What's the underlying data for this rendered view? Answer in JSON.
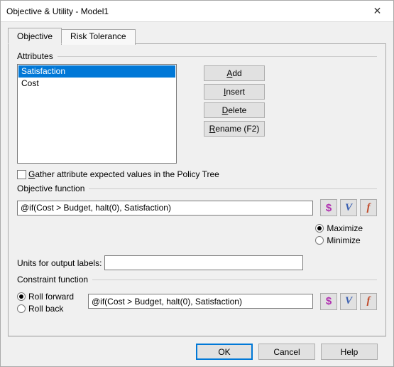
{
  "window": {
    "title": "Objective & Utility - Model1"
  },
  "tabs": {
    "objective": "Objective",
    "risk_tolerance": "Risk Tolerance"
  },
  "attributes": {
    "group_label": "Attributes",
    "items": [
      "Satisfaction",
      "Cost"
    ],
    "selected_index": 0,
    "buttons": {
      "add": "Add",
      "insert": "Insert",
      "delete": "Delete",
      "rename": "Rename (F2)"
    },
    "gather_checkbox": "Gather attribute expected values in the Policy Tree",
    "gather_checked": false
  },
  "objective_function": {
    "group_label": "Objective function",
    "value": "@if(Cost > Budget, halt(0), Satisfaction)",
    "maximize_label": "Maximize",
    "minimize_label": "Minimize",
    "direction": "maximize"
  },
  "units": {
    "label": "Units for output labels:",
    "value": ""
  },
  "constraint_function": {
    "group_label": "Constraint function",
    "roll_forward_label": "Roll forward",
    "roll_back_label": "Roll back",
    "mode": "roll_forward",
    "value": "@if(Cost > Budget, halt(0), Satisfaction)"
  },
  "icon_buttons": {
    "dollar": "$",
    "v": "V",
    "f": "f"
  },
  "footer": {
    "ok": "OK",
    "cancel": "Cancel",
    "help": "Help"
  }
}
